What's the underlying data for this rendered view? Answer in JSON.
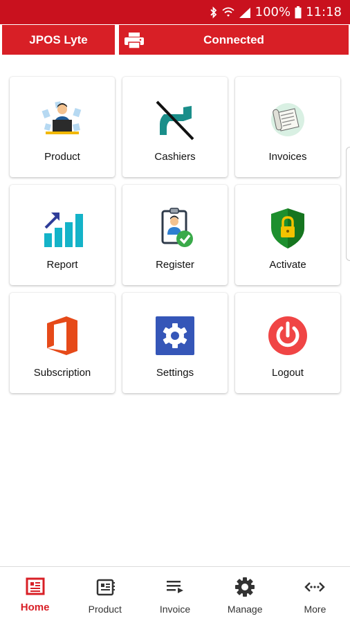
{
  "status_bar": {
    "battery": "100%",
    "time": "11:18"
  },
  "header": {
    "app_title": "JPOS Lyte",
    "connection_status": "Connected"
  },
  "tiles": [
    {
      "label": "Product",
      "icon": "product-icon"
    },
    {
      "label": "Cashiers",
      "icon": "cashiers-icon"
    },
    {
      "label": "Invoices",
      "icon": "invoices-icon"
    },
    {
      "label": "Report",
      "icon": "report-icon"
    },
    {
      "label": "Register",
      "icon": "register-icon"
    },
    {
      "label": "Activate",
      "icon": "activate-icon"
    },
    {
      "label": "Subscription",
      "icon": "subscription-icon"
    },
    {
      "label": "Settings",
      "icon": "settings-icon"
    },
    {
      "label": "Logout",
      "icon": "logout-icon"
    }
  ],
  "bottom_nav": {
    "items": [
      {
        "label": "Home",
        "active": true
      },
      {
        "label": "Product"
      },
      {
        "label": "Invoice"
      },
      {
        "label": "Manage"
      },
      {
        "label": "More"
      }
    ]
  },
  "colors": {
    "brand_red": "#d81f26",
    "status_red": "#c9111e"
  }
}
